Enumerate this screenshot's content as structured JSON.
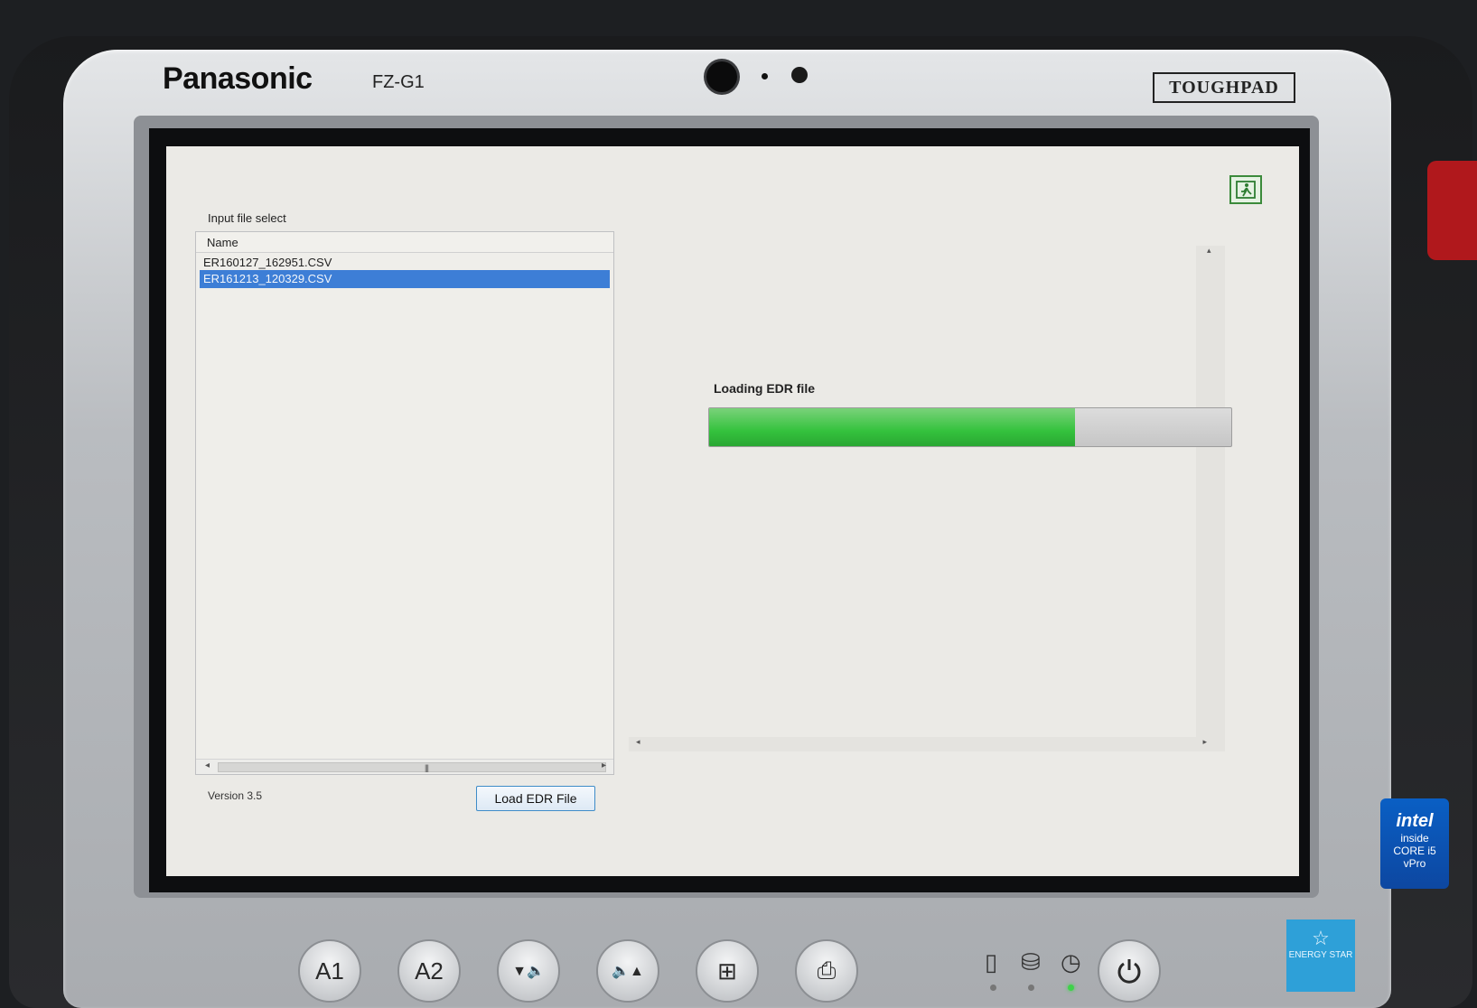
{
  "device": {
    "brand": "Panasonic",
    "model": "FZ-G1",
    "badge": "TOUGHPAD",
    "hw_buttons": [
      "A1",
      "A2",
      "▼🔈",
      "🔈▲",
      "⊞",
      "⎙"
    ],
    "intel_badge": {
      "logo": "intel",
      "line1": "inside",
      "line2": "CORE i5",
      "line3": "vPro"
    },
    "energy_badge": "ENERGY STAR"
  },
  "app": {
    "panel_title": "Input file select",
    "column_header": "Name",
    "files": [
      {
        "name": "ER160127_162951.CSV",
        "selected": false
      },
      {
        "name": "ER161213_120329.CSV",
        "selected": true
      }
    ],
    "version": "Version 3.5",
    "load_button": "Load EDR File",
    "loading_label": "Loading EDR file",
    "progress_fraction": 0.7,
    "exit_icon": "exit-icon",
    "colors": {
      "selection": "#3d7ed6",
      "progress": "#34c23d"
    }
  }
}
